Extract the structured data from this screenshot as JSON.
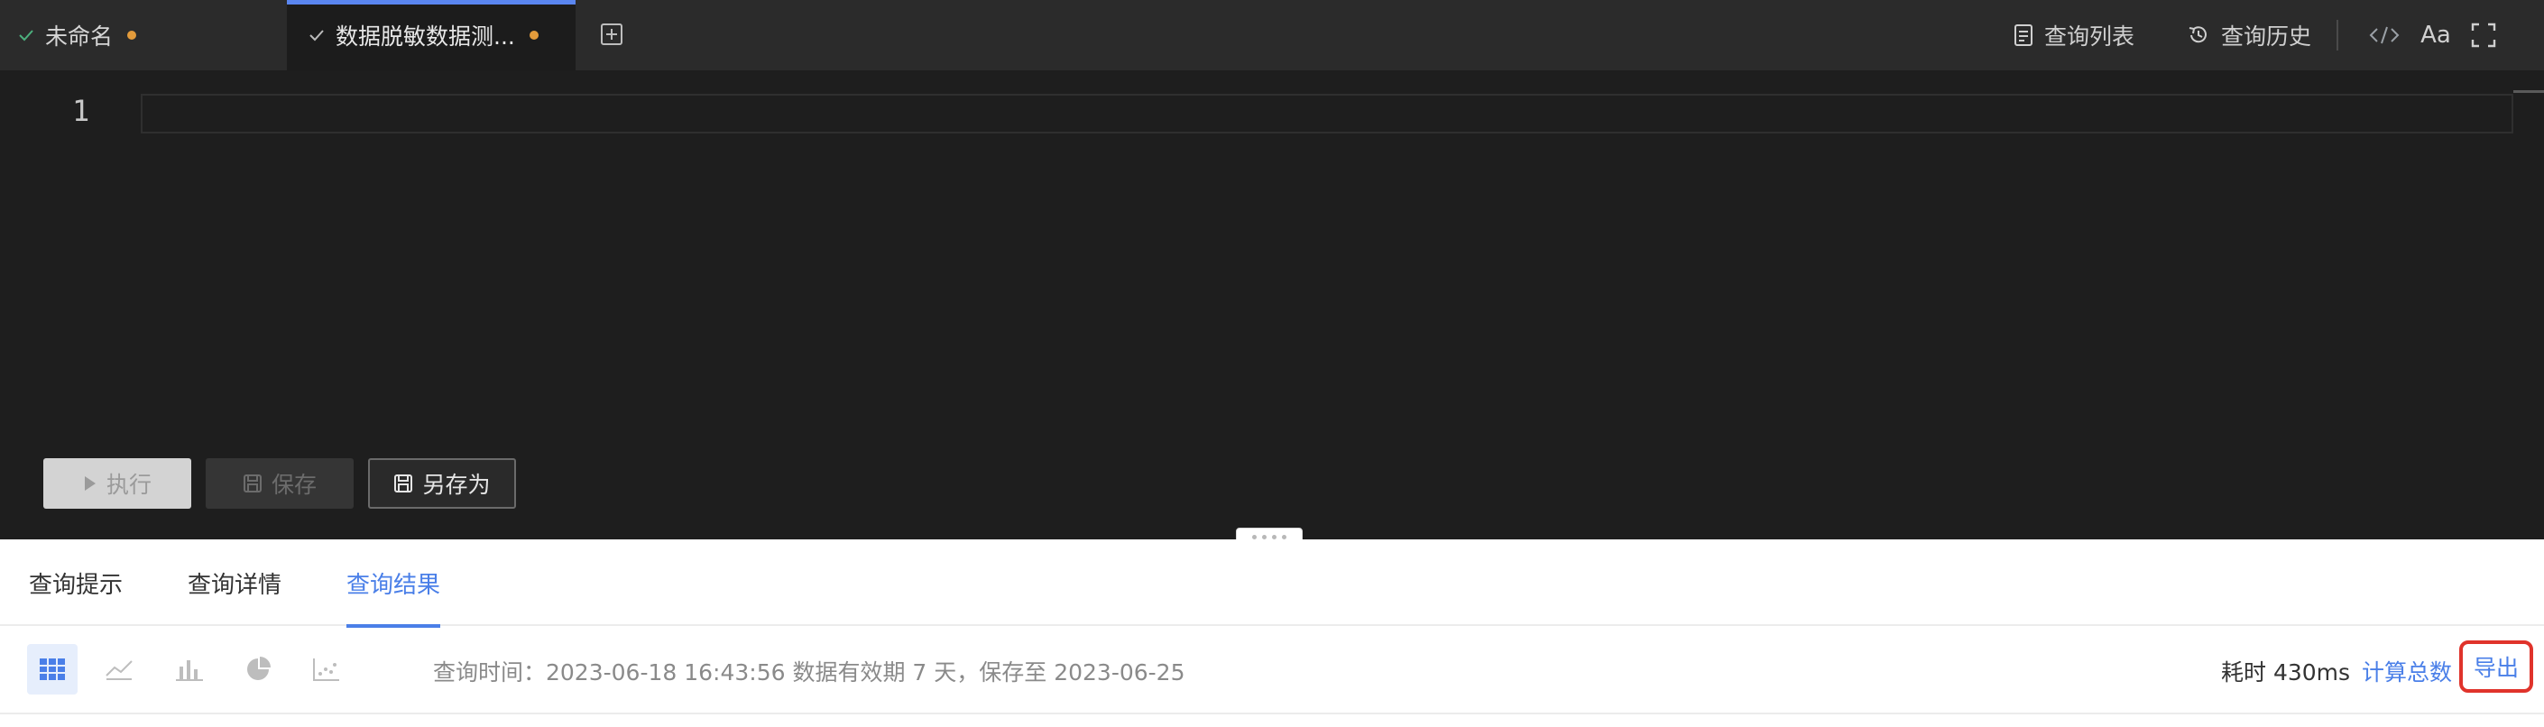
{
  "tabs": [
    {
      "label": "未命名",
      "active": false,
      "modified": true
    },
    {
      "label": "数据脱敏数据测...",
      "active": true,
      "modified": true
    }
  ],
  "toolbar_right": {
    "query_list": "查询列表",
    "query_history": "查询历史",
    "font_size_label": "Aa"
  },
  "editor": {
    "line_numbers": [
      "1"
    ]
  },
  "actions": {
    "run": "执行",
    "save": "保存",
    "save_as": "另存为"
  },
  "bottom_tabs": [
    {
      "label": "查询提示",
      "active": false
    },
    {
      "label": "查询详情",
      "active": false
    },
    {
      "label": "查询结果",
      "active": true
    }
  ],
  "result": {
    "query_info": "查询时间：2023-06-18 16:43:56 数据有效期 7 天，保存至 2023-06-25",
    "elapsed": "耗时 430ms",
    "count_link": "计算总数",
    "export": "导出",
    "view_icons": [
      "table-icon",
      "line-chart-icon",
      "bar-chart-icon",
      "pie-chart-icon",
      "scatter-chart-icon"
    ],
    "active_view": "table-icon"
  },
  "colors": {
    "accent": "#4a7fe8",
    "modified_dot": "#e39b3b",
    "export_highlight": "#e0332b"
  }
}
